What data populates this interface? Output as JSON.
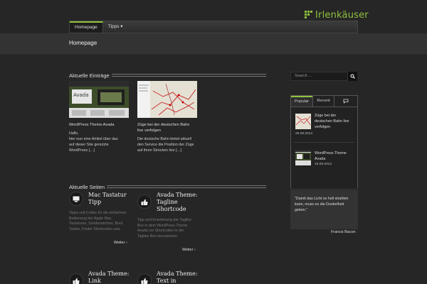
{
  "header": {
    "logo_text": "Irlenkäuser"
  },
  "nav": {
    "items": [
      {
        "label": "Homepage"
      },
      {
        "label": "Tipps ▾"
      }
    ]
  },
  "page": {
    "title": "Homepage"
  },
  "recent_posts": {
    "heading": "Aktuelle Einträge",
    "posts": [
      {
        "title": "WordPress Theme Avada",
        "excerpt_lines": [
          "Hallo,",
          "hier nun eine Artikel über das",
          "auf dieser Site genutzte",
          "WordPress […]"
        ]
      },
      {
        "title_lines": [
          "Züge bei der deutschen Bahn",
          "live verfolgen"
        ],
        "excerpt_lines": [
          "Die deutsche Bahn bietet aktuell",
          "den Service die Position der Züge",
          "auf ihren Strecken live […]"
        ]
      }
    ]
  },
  "recent_pages": {
    "heading": "Aktuelle Seiten",
    "pages": [
      {
        "title_lines": [
          "Mac Tastatur",
          "Tipp"
        ],
        "text_lines": [
          "Tipps und Codes für die einfachere",
          "Bedienung der Apple Mac",
          "Tastaturen, Sonderzeichen, Boot",
          "Tasten, Finder Shortcodes uvw."
        ],
        "more": "Weiter ›"
      },
      {
        "title_lines": [
          "Avada Theme:",
          "Tagline",
          "Shortcode"
        ],
        "text_lines": [
          "Tipp und Erweiterung der Tagline",
          "Box in dem WordPress Theme",
          "Avada um Shortcodes in der",
          "Tagline Box einzusetzen."
        ],
        "more": "Weiter ›"
      },
      {
        "title_lines": [
          "Avada Theme:",
          "Link"
        ]
      },
      {
        "title_lines": [
          "Avada Theme:",
          "Text in"
        ]
      }
    ]
  },
  "sidebar": {
    "search_placeholder": "Search ...",
    "tabs": [
      "Popular",
      "Recent"
    ],
    "popular": [
      {
        "title_lines": [
          "Züge bei der",
          "deutschen Bahn live",
          "verfolgen"
        ],
        "date": "26.08.2013"
      },
      {
        "title_lines": [
          "WordPress Theme",
          "Avada"
        ],
        "date": "15.09.2013"
      }
    ],
    "quote_lines": [
      "\"Damit das Licht so hell strahlen",
      "kann, muss es die Dunkelheit",
      "geben.\""
    ],
    "quote_author": "Francis Bacon"
  },
  "colors": {
    "accent": "#8fc13e",
    "background": "#262626"
  }
}
